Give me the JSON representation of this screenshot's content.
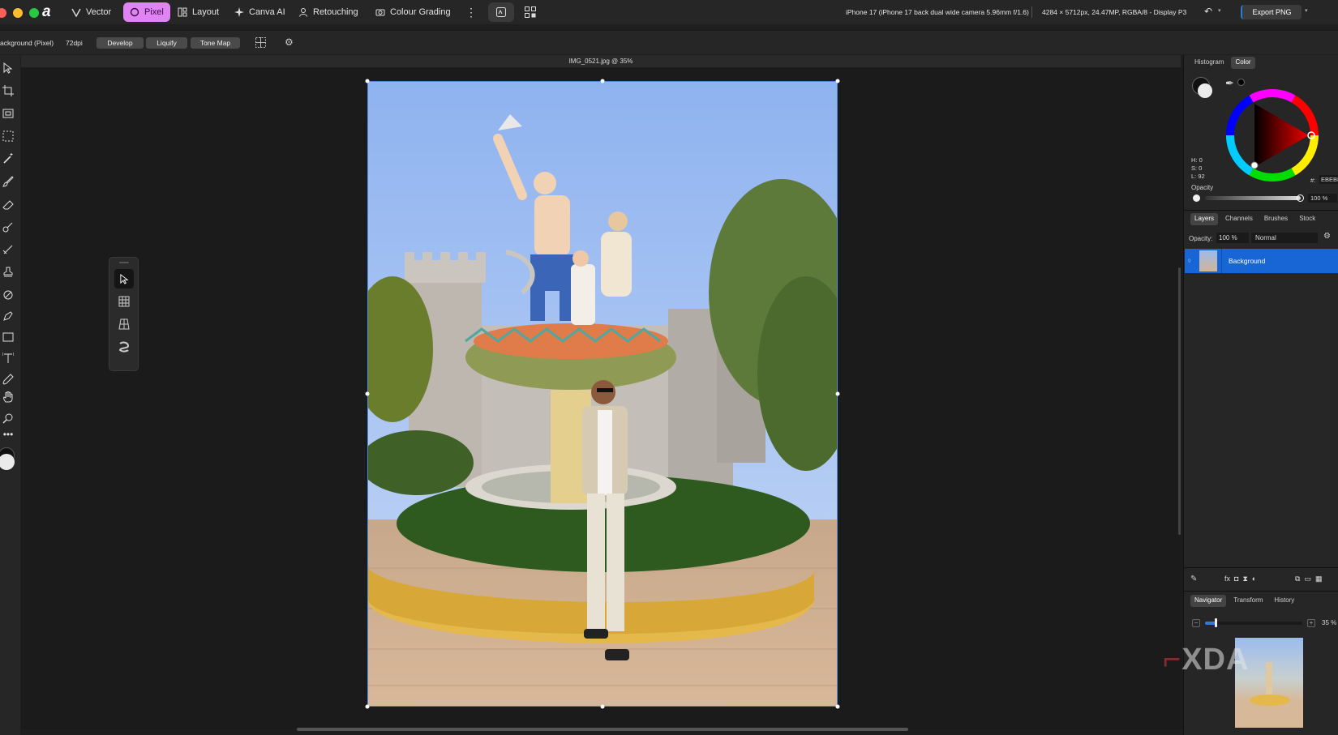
{
  "topbar": {
    "personas": [
      {
        "label": "Vector",
        "icon": "vector-icon"
      },
      {
        "label": "Pixel",
        "icon": "pixel-icon",
        "active": true
      },
      {
        "label": "Layout",
        "icon": "layout-icon"
      },
      {
        "label": "Canva AI",
        "icon": "sparkle-icon"
      },
      {
        "label": "Retouching",
        "icon": "person-icon"
      },
      {
        "label": "Colour Grading",
        "icon": "camera-icon"
      }
    ],
    "camera_info": "iPhone 17 (iPhone 17 back dual wide camera 5.96mm f/1.6)",
    "image_info": "4284 × 5712px, 24.47MP, RGBA/8 - Display P3",
    "export_label": "Export PNG"
  },
  "context": {
    "layer_name": "ackground (Pixel)",
    "dpi": "72dpi",
    "buttons": [
      "Develop",
      "Liquify",
      "Tone Map"
    ]
  },
  "document": {
    "title": "IMG_0521.jpg @ 35%"
  },
  "color_panel": {
    "tabs": [
      "Histogram",
      "Color"
    ],
    "active_tab": "Color",
    "h": "H: 0",
    "s": "S: 0",
    "l": "L: 92",
    "hex_label": "#:",
    "hex_value": "EBEBEB",
    "opacity_label": "Opacity",
    "opacity_value": "100 %"
  },
  "layers_panel": {
    "tabs": [
      "Layers",
      "Channels",
      "Brushes",
      "Stock"
    ],
    "active_tab": "Layers",
    "opacity_label": "Opacity:",
    "opacity_value": "100 %",
    "blend_mode": "Normal",
    "layer_name": "Background"
  },
  "navigator_panel": {
    "tabs": [
      "Navigator",
      "Transform",
      "History"
    ],
    "active_tab": "Navigator",
    "zoom": "35 %"
  },
  "watermark": "XDA",
  "colors": {
    "accent": "#1866d6",
    "pixel_persona": "#e184f3",
    "selection": "#4d8ae0"
  }
}
